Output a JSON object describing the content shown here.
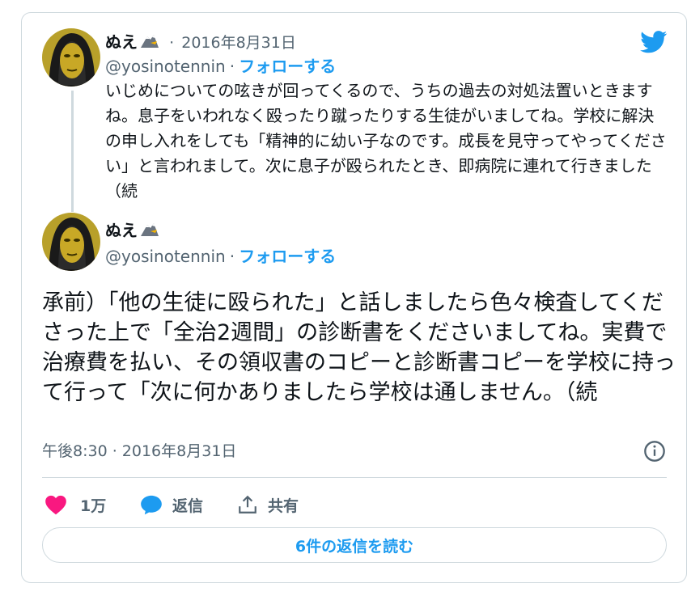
{
  "parent_tweet": {
    "author_name": "ぬえ",
    "date_separator": "·",
    "date": "2016年8月31日",
    "handle": "@yosinotennin",
    "handle_separator": "·",
    "follow_label": "フォローする",
    "text": "いじめについての呟きが回ってくるので、うちの過去の対処法置いときますね。息子をいわれなく殴ったり蹴ったりする生徒がいましてね。学校に解決の申し入れをしても「精神的に幼い子なのです。成長を見守ってやってください」と言われまして。次に息子が殴られたとき、即病院に連れて行きました（続"
  },
  "main_tweet": {
    "author_name": "ぬえ",
    "handle": "@yosinotennin",
    "handle_separator": "·",
    "follow_label": "フォローする",
    "text": "承前）「他の生徒に殴られた」と話しましたら色々検査してくださった上で「全治2週間」の診断書をくださいましてね。実費で治療費を払い、その領収書のコピーと診断書コピーを学校に持って行って「次に何かありましたら学校は通しません。（続",
    "timestamp": "午後8:30 · 2016年8月31日"
  },
  "actions": {
    "like_count": "1万",
    "reply_label": "返信",
    "share_label": "共有"
  },
  "read_replies_label": "6件の返信を読む",
  "icons": {
    "brand": "twitter-bird-icon",
    "info": "info-icon",
    "like": "heart-icon",
    "reply": "speech-bubble-icon",
    "share": "share-icon",
    "name_emoji": "eagle-icon"
  },
  "colors": {
    "accent": "#1d9bf0",
    "like": "#f91880",
    "text": "#0f1419",
    "secondary": "#536471",
    "border": "#cfd9de"
  }
}
